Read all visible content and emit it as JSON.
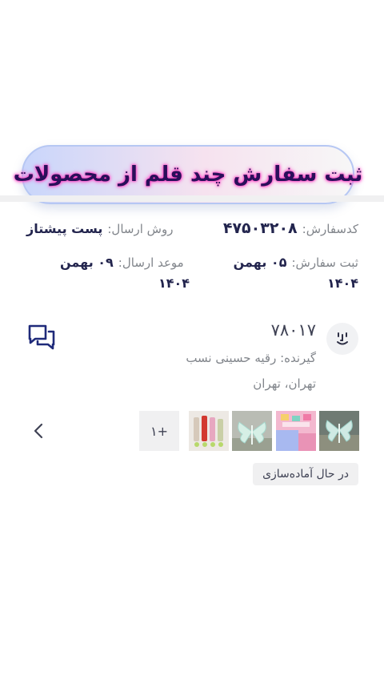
{
  "banner": {
    "title": "ثبت سفارش چند قلم از محصولات"
  },
  "order": {
    "code_label": "کدسفارش:",
    "code_value": "۴۷۵۰۳۲۰۸",
    "shipping_method_label": "روش ارسال:",
    "shipping_method_value": "پست پیشتاز",
    "registered_label": "ثبت سفارش:",
    "registered_value_line1": "۰۵ بهمن",
    "registered_value_line2": "۱۴۰۴",
    "delivery_label": "موعد ارسال:",
    "delivery_value_line1": "۰۹ بهمن",
    "delivery_value_line2": "۱۴۰۴"
  },
  "shipment": {
    "tracking_number": "۷۸۰۱۷",
    "recipient": "گیرنده: رقیه حسینی نسب",
    "address": "تهران، تهران"
  },
  "items": {
    "more_count": "+۱",
    "thumbnails": [
      "butterfly-clip-white",
      "clips-pink-blue",
      "butterfly-clip-white-2",
      "lipstick-set"
    ]
  },
  "status": {
    "label": "در حال آماده‌سازی"
  },
  "icons": {
    "chat": "chat-bubbles-icon",
    "avatar": "courier-face-icon",
    "chevron": "chevron-left-icon"
  },
  "colors": {
    "accent_dark": "#23254e",
    "chat_icon": "#1f2a7a",
    "muted": "#81858b",
    "divider": "#f0f0f1"
  }
}
